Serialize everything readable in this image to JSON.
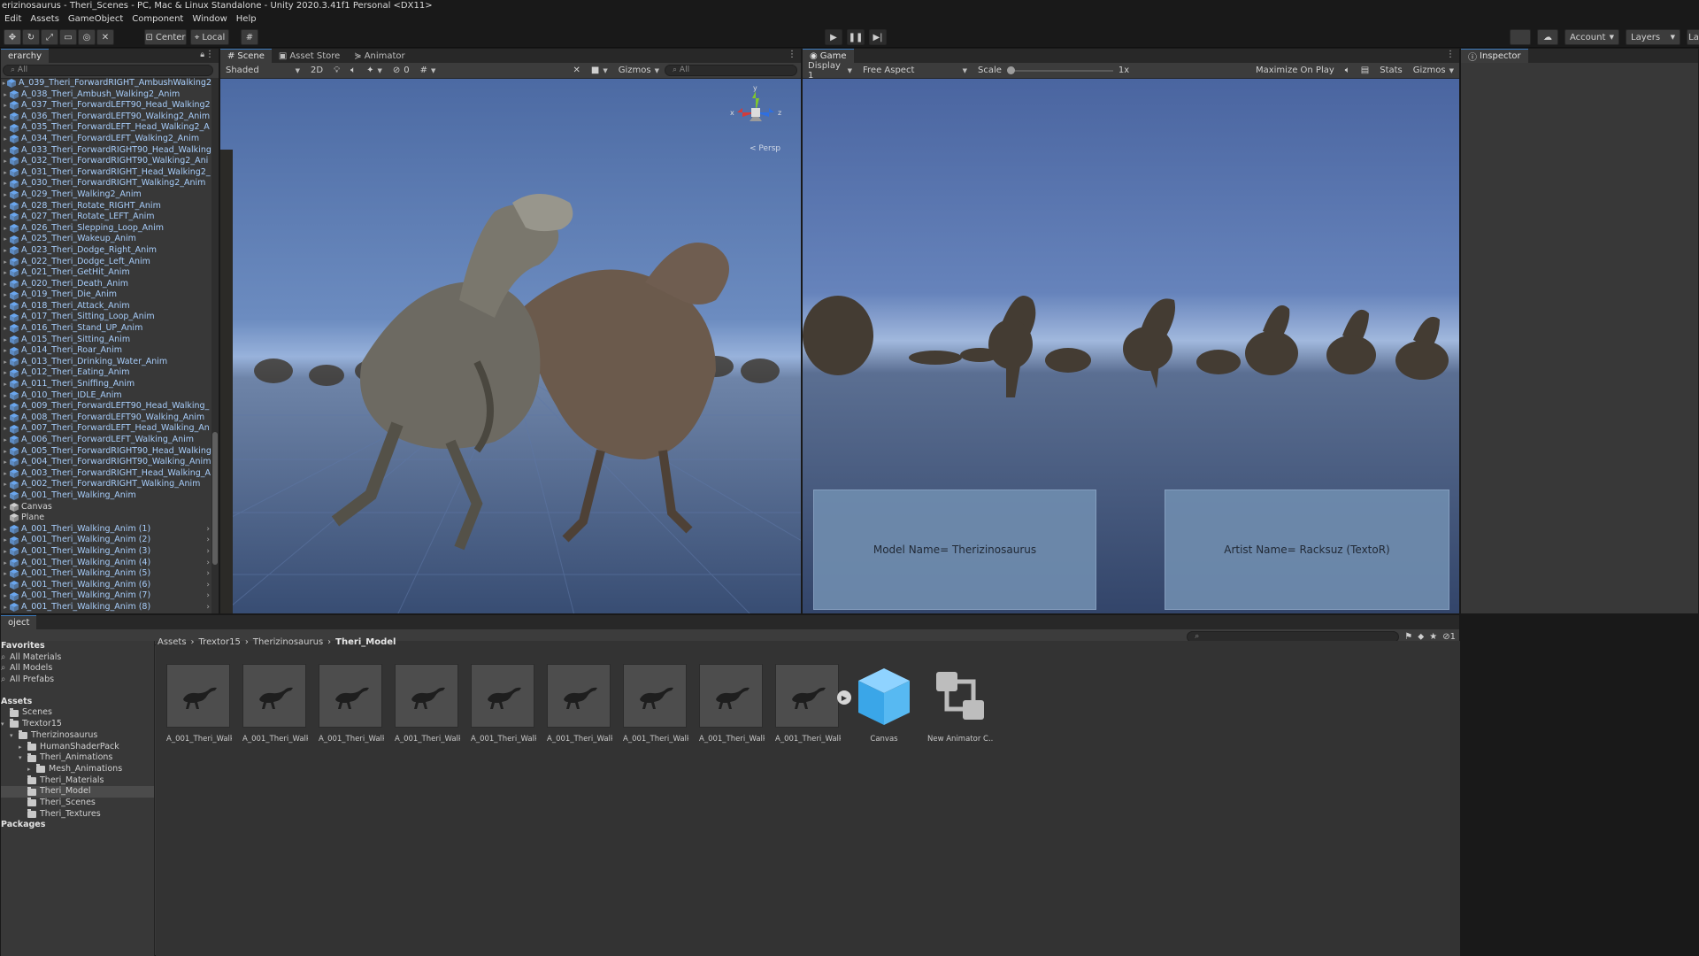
{
  "window": {
    "title": "erizinosaurus - Theri_Scenes - PC, Mac & Linux Standalone - Unity 2020.3.41f1 Personal <DX11>"
  },
  "menu": [
    "Edit",
    "Assets",
    "GameObject",
    "Component",
    "Window",
    "Help"
  ],
  "toolbar": {
    "pivot_label": "Center",
    "space_label": "Local",
    "account_label": "Account",
    "layers_label": "Layers",
    "layout_label": "La"
  },
  "hierarchy": {
    "title": "erarchy",
    "search_placeholder": "All",
    "items": [
      "A_039_Theri_ForwardRIGHT_AmbushWalking2",
      "A_038_Theri_Ambush_Walking2_Anim",
      "A_037_Theri_ForwardLEFT90_Head_Walking2",
      "A_036_Theri_ForwardLEFT90_Walking2_Anim",
      "A_035_Theri_ForwardLEFT_Head_Walking2_A",
      "A_034_Theri_ForwardLEFT_Walking2_Anim",
      "A_033_Theri_ForwardRIGHT90_Head_Walking",
      "A_032_Theri_ForwardRIGHT90_Walking2_Ani",
      "A_031_Theri_ForwardRIGHT_Head_Walking2_",
      "A_030_Theri_ForwardRIGHT_Walking2_Anim",
      "A_029_Theri_Walking2_Anim",
      "A_028_Theri_Rotate_RIGHT_Anim",
      "A_027_Theri_Rotate_LEFT_Anim",
      "A_026_Theri_Slepping_Loop_Anim",
      "A_025_Theri_Wakeup_Anim",
      "A_023_Theri_Dodge_Right_Anim",
      "A_022_Theri_Dodge_Left_Anim",
      "A_021_Theri_GetHit_Anim",
      "A_020_Theri_Death_Anim",
      "A_019_Theri_Die_Anim",
      "A_018_Theri_Attack_Anim",
      "A_017_Theri_Sitting_Loop_Anim",
      "A_016_Theri_Stand_UP_Anim",
      "A_015_Theri_Sitting_Anim",
      "A_014_Theri_Roar_Anim",
      "A_013_Theri_Drinking_Water_Anim",
      "A_012_Theri_Eating_Anim",
      "A_011_Theri_Sniffing_Anim",
      "A_010_Theri_IDLE_Anim",
      "A_009_Theri_ForwardLEFT90_Head_Walking_",
      "A_008_Theri_ForwardLEFT90_Walking_Anim",
      "A_007_Theri_ForwardLEFT_Head_Walking_An",
      "A_006_Theri_ForwardLEFT_Walking_Anim",
      "A_005_Theri_ForwardRIGHT90_Head_Walking",
      "A_004_Theri_ForwardRIGHT90_Walking_Anim",
      "A_003_Theri_ForwardRIGHT_Head_Walking_A",
      "A_002_Theri_ForwardRIGHT_Walking_Anim",
      "A_001_Theri_Walking_Anim"
    ],
    "objects": [
      "Canvas",
      "Plane"
    ],
    "prefab_items": [
      "A_001_Theri_Walking_Anim (1)",
      "A_001_Theri_Walking_Anim (2)",
      "A_001_Theri_Walking_Anim (3)",
      "A_001_Theri_Walking_Anim (4)",
      "A_001_Theri_Walking_Anim (5)",
      "A_001_Theri_Walking_Anim (6)",
      "A_001_Theri_Walking_Anim (7)",
      "A_001_Theri_Walking_Anim (8)"
    ]
  },
  "scene": {
    "tabs": [
      "Scene",
      "Asset Store",
      "Animator"
    ],
    "shading_mode": "Shaded",
    "mode_2d": "2D",
    "fx_count": "0",
    "gizmos_label": "Gizmos",
    "search_placeholder": "All",
    "persp_label": "< Persp",
    "axis_x": "x",
    "axis_y": "y",
    "axis_z": "z"
  },
  "game": {
    "tab": "Game",
    "display": "Display 1",
    "aspect": "Free Aspect",
    "scale_label": "Scale",
    "scale_value": "1x",
    "maximize_label": "Maximize On Play",
    "stats_label": "Stats",
    "gizmos_label": "Gizmos",
    "model_box": "Model Name= Therizinosaurus",
    "artist_box": "Artist Name= Racksuz (TextoR)"
  },
  "inspector": {
    "tab": "Inspector"
  },
  "project": {
    "tab": "oject",
    "hidden_count": "1",
    "favorites_header": "Favorites",
    "favorites": [
      "All Materials",
      "All Models",
      "All Prefabs"
    ],
    "assets_header": "Assets",
    "tree": [
      {
        "label": "Scenes",
        "indent": 0,
        "arrow": ""
      },
      {
        "label": "Trextor15",
        "indent": 0,
        "arrow": "▾"
      },
      {
        "label": "Therizinosaurus",
        "indent": 1,
        "arrow": "▾"
      },
      {
        "label": "HumanShaderPack",
        "indent": 2,
        "arrow": "▸"
      },
      {
        "label": "Theri_Animations",
        "indent": 2,
        "arrow": "▾"
      },
      {
        "label": "Mesh_Animations",
        "indent": 3,
        "arrow": "▸"
      },
      {
        "label": "Theri_Materials",
        "indent": 2,
        "arrow": ""
      },
      {
        "label": "Theri_Model",
        "indent": 2,
        "arrow": ""
      },
      {
        "label": "Theri_Scenes",
        "indent": 2,
        "arrow": ""
      },
      {
        "label": "Theri_Textures",
        "indent": 2,
        "arrow": ""
      }
    ],
    "packages_header": "Packages",
    "breadcrumb": [
      "Assets",
      "Trextor15",
      "Therizinosaurus",
      "Theri_Model"
    ],
    "assets": [
      "A_001_Theri_Walk...",
      "A_001_Theri_Walk...",
      "A_001_Theri_Walk...",
      "A_001_Theri_Walk...",
      "A_001_Theri_Walk...",
      "A_001_Theri_Walk...",
      "A_001_Theri_Walk...",
      "A_001_Theri_Walk...",
      "A_001_Theri_Walk...",
      "Canvas",
      "New Animator C..."
    ]
  }
}
